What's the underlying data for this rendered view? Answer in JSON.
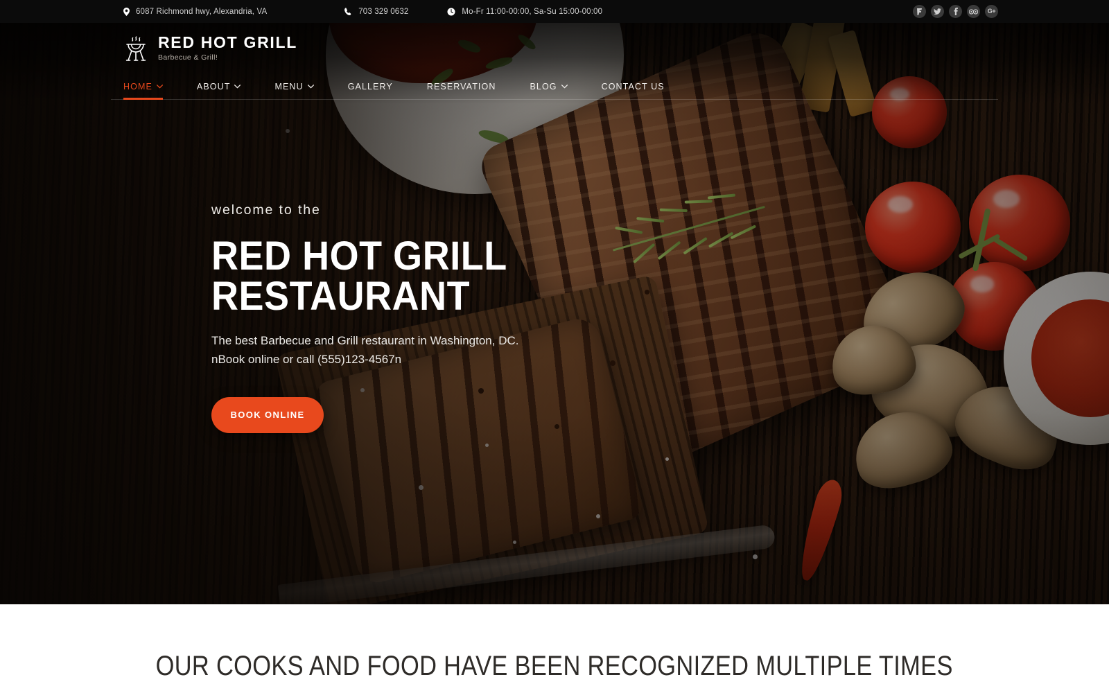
{
  "topbar": {
    "address": "6087 Richmond hwy, Alexandria, VA",
    "phone": "703 329 0632",
    "hours": "Mo-Fr 11:00-00:00, Sa-Su 15:00-00:00",
    "address_icon": "map-pin-icon",
    "phone_icon": "phone-icon",
    "hours_icon": "clock-icon",
    "socials": [
      {
        "name": "foursquare",
        "glyph": "Ⓕ"
      },
      {
        "name": "twitter",
        "glyph": "ᴠ"
      },
      {
        "name": "facebook",
        "glyph": "f"
      },
      {
        "name": "tripadvisor",
        "glyph": "◎"
      },
      {
        "name": "google-plus",
        "glyph": "G+"
      }
    ],
    "background_color": "#0b0b0b"
  },
  "brand": {
    "name": "RED HOT GRILL",
    "tagline": "Barbecue & Grill!",
    "icon": "bbq-grill-icon"
  },
  "nav": {
    "items": [
      {
        "label": "HOME",
        "active": true,
        "dropdown": true
      },
      {
        "label": "ABOUT",
        "active": false,
        "dropdown": true
      },
      {
        "label": "MENU",
        "active": false,
        "dropdown": true
      },
      {
        "label": "GALLERY",
        "active": false,
        "dropdown": false
      },
      {
        "label": "RESERVATION",
        "active": false,
        "dropdown": false
      },
      {
        "label": "BLOG",
        "active": false,
        "dropdown": true
      },
      {
        "label": "CONTACT US",
        "active": false,
        "dropdown": false
      }
    ],
    "active_color": "#e8491d"
  },
  "hero": {
    "eyebrow": "welcome to the",
    "headline": "RED HOT GRILL RESTAURANT",
    "subtext_line1": "The best Barbecue and Grill restaurant in Washington, DC.",
    "subtext_line2": "nBook online or call (555)123-4567n",
    "cta_label": "BOOK ONLINE",
    "cta_color": "#e8491d"
  },
  "recognition": {
    "title": "OUR COOKS AND FOOD HAVE BEEN RECOGNIZED MULTIPLE TIMES"
  }
}
